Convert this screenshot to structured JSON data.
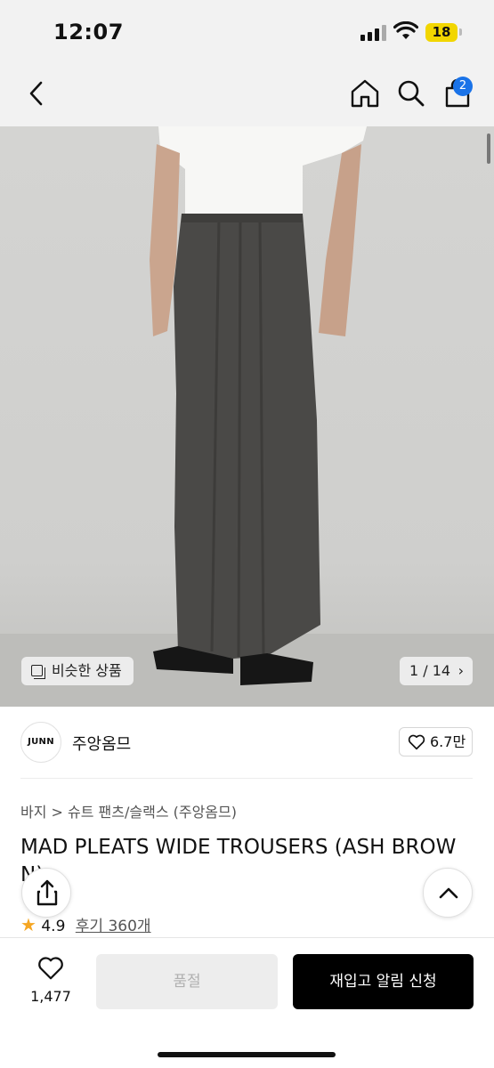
{
  "status_bar": {
    "time": "12:07",
    "battery": "18"
  },
  "header": {
    "cart_count": "2"
  },
  "hero": {
    "similar_label": "비슷한 상품",
    "image_counter": "1 / 14",
    "counter_chevron": "›"
  },
  "brand": {
    "logo_text": "JUNN",
    "name": "주앙옴므",
    "likes": "6.7만"
  },
  "breadcrumb": "바지 > 슈트 팬츠/슬랙스 (주앙옴므)",
  "product": {
    "title_line1": "MAD PLEATS WIDE TROUSERS (ASH BROW",
    "title_line2": "N)"
  },
  "rating": {
    "star": "★",
    "score": "4.9",
    "reviews": "후기 360개"
  },
  "bottom_bar": {
    "wish_count": "1,477",
    "soldout_label": "품절",
    "restock_label": "재입고 알림 신청"
  },
  "colors": {
    "badge": "#1a73e8",
    "star": "#f5a623",
    "cta": "#000000",
    "battery": "#f2d600"
  },
  "icons": [
    "back-icon",
    "home-icon",
    "search-icon",
    "shopping-bag-icon",
    "similar-items-icon",
    "heart-icon",
    "share-icon",
    "chevron-up-icon",
    "star-icon"
  ]
}
